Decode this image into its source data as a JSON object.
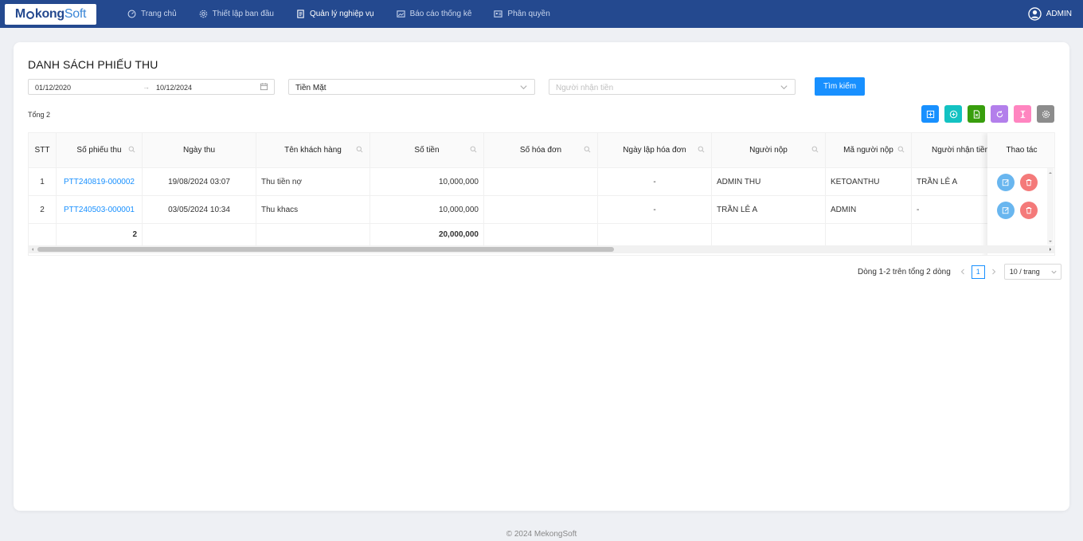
{
  "brand": {
    "logo_text_a": "Me",
    "logo_text_b": "kong",
    "logo_text_c": "Soft"
  },
  "nav": [
    {
      "label": "Trang chủ",
      "icon": "dashboard-icon"
    },
    {
      "label": "Thiết lập ban đầu",
      "icon": "settings-icon"
    },
    {
      "label": "Quản lý nghiệp vụ",
      "icon": "document-icon",
      "active": true
    },
    {
      "label": "Báo cáo thống kê",
      "icon": "image-report-icon"
    },
    {
      "label": "Phân quyền",
      "icon": "id-card-icon"
    }
  ],
  "user": {
    "name": "ADMIN"
  },
  "page": {
    "title": "DANH SÁCH PHIẾU THU",
    "total_label": "Tổng 2"
  },
  "filters": {
    "date_from": "01/12/2020",
    "date_arrow": "→",
    "date_to": "10/12/2024",
    "payment_method": "Tiền Mặt",
    "receiver_placeholder": "Người nhận tiền",
    "search_button": "Tìm kiếm"
  },
  "toolbar": {
    "colors": [
      "#1890ff",
      "#13c2c2",
      "#389e0d",
      "#b37feb",
      "#ff85c0",
      "#8c8c8c"
    ]
  },
  "table": {
    "headers": {
      "stt": "STT",
      "code": "Số phiếu thu",
      "date": "Ngày thu",
      "customer": "Tên khách hàng",
      "amount": "Số tiền",
      "invoice_no": "Số hóa đơn",
      "invoice_date": "Ngày lập hóa đơn",
      "payer": "Người nộp",
      "payer_code": "Mã người nộp",
      "receiver": "Người nhận tiền",
      "actions": "Thao tác"
    },
    "rows": [
      {
        "stt": "1",
        "code": "PTT240819-000002",
        "date": "19/08/2024 03:07",
        "customer": "Thu tiền nợ",
        "amount": "10,000,000",
        "invoice_no": "",
        "invoice_date": "-",
        "payer": "ADMIN THU",
        "payer_code": "KETOANTHU",
        "receiver": "TRẦN LÊ A"
      },
      {
        "stt": "2",
        "code": "PTT240503-000001",
        "date": "03/05/2024 10:34",
        "customer": "Thu khacs",
        "amount": "10,000,000",
        "invoice_no": "",
        "invoice_date": "-",
        "payer": "TRẦN LÊ A",
        "payer_code": "ADMIN",
        "receiver": "-"
      }
    ],
    "summary": {
      "count": "2",
      "amount": "20,000,000"
    }
  },
  "pagination": {
    "range_text": "Dòng 1-2 trên tổng 2 dòng",
    "current_page": "1",
    "page_size": "10 / trang"
  },
  "footer": {
    "text": "© 2024 MekongSoft"
  }
}
